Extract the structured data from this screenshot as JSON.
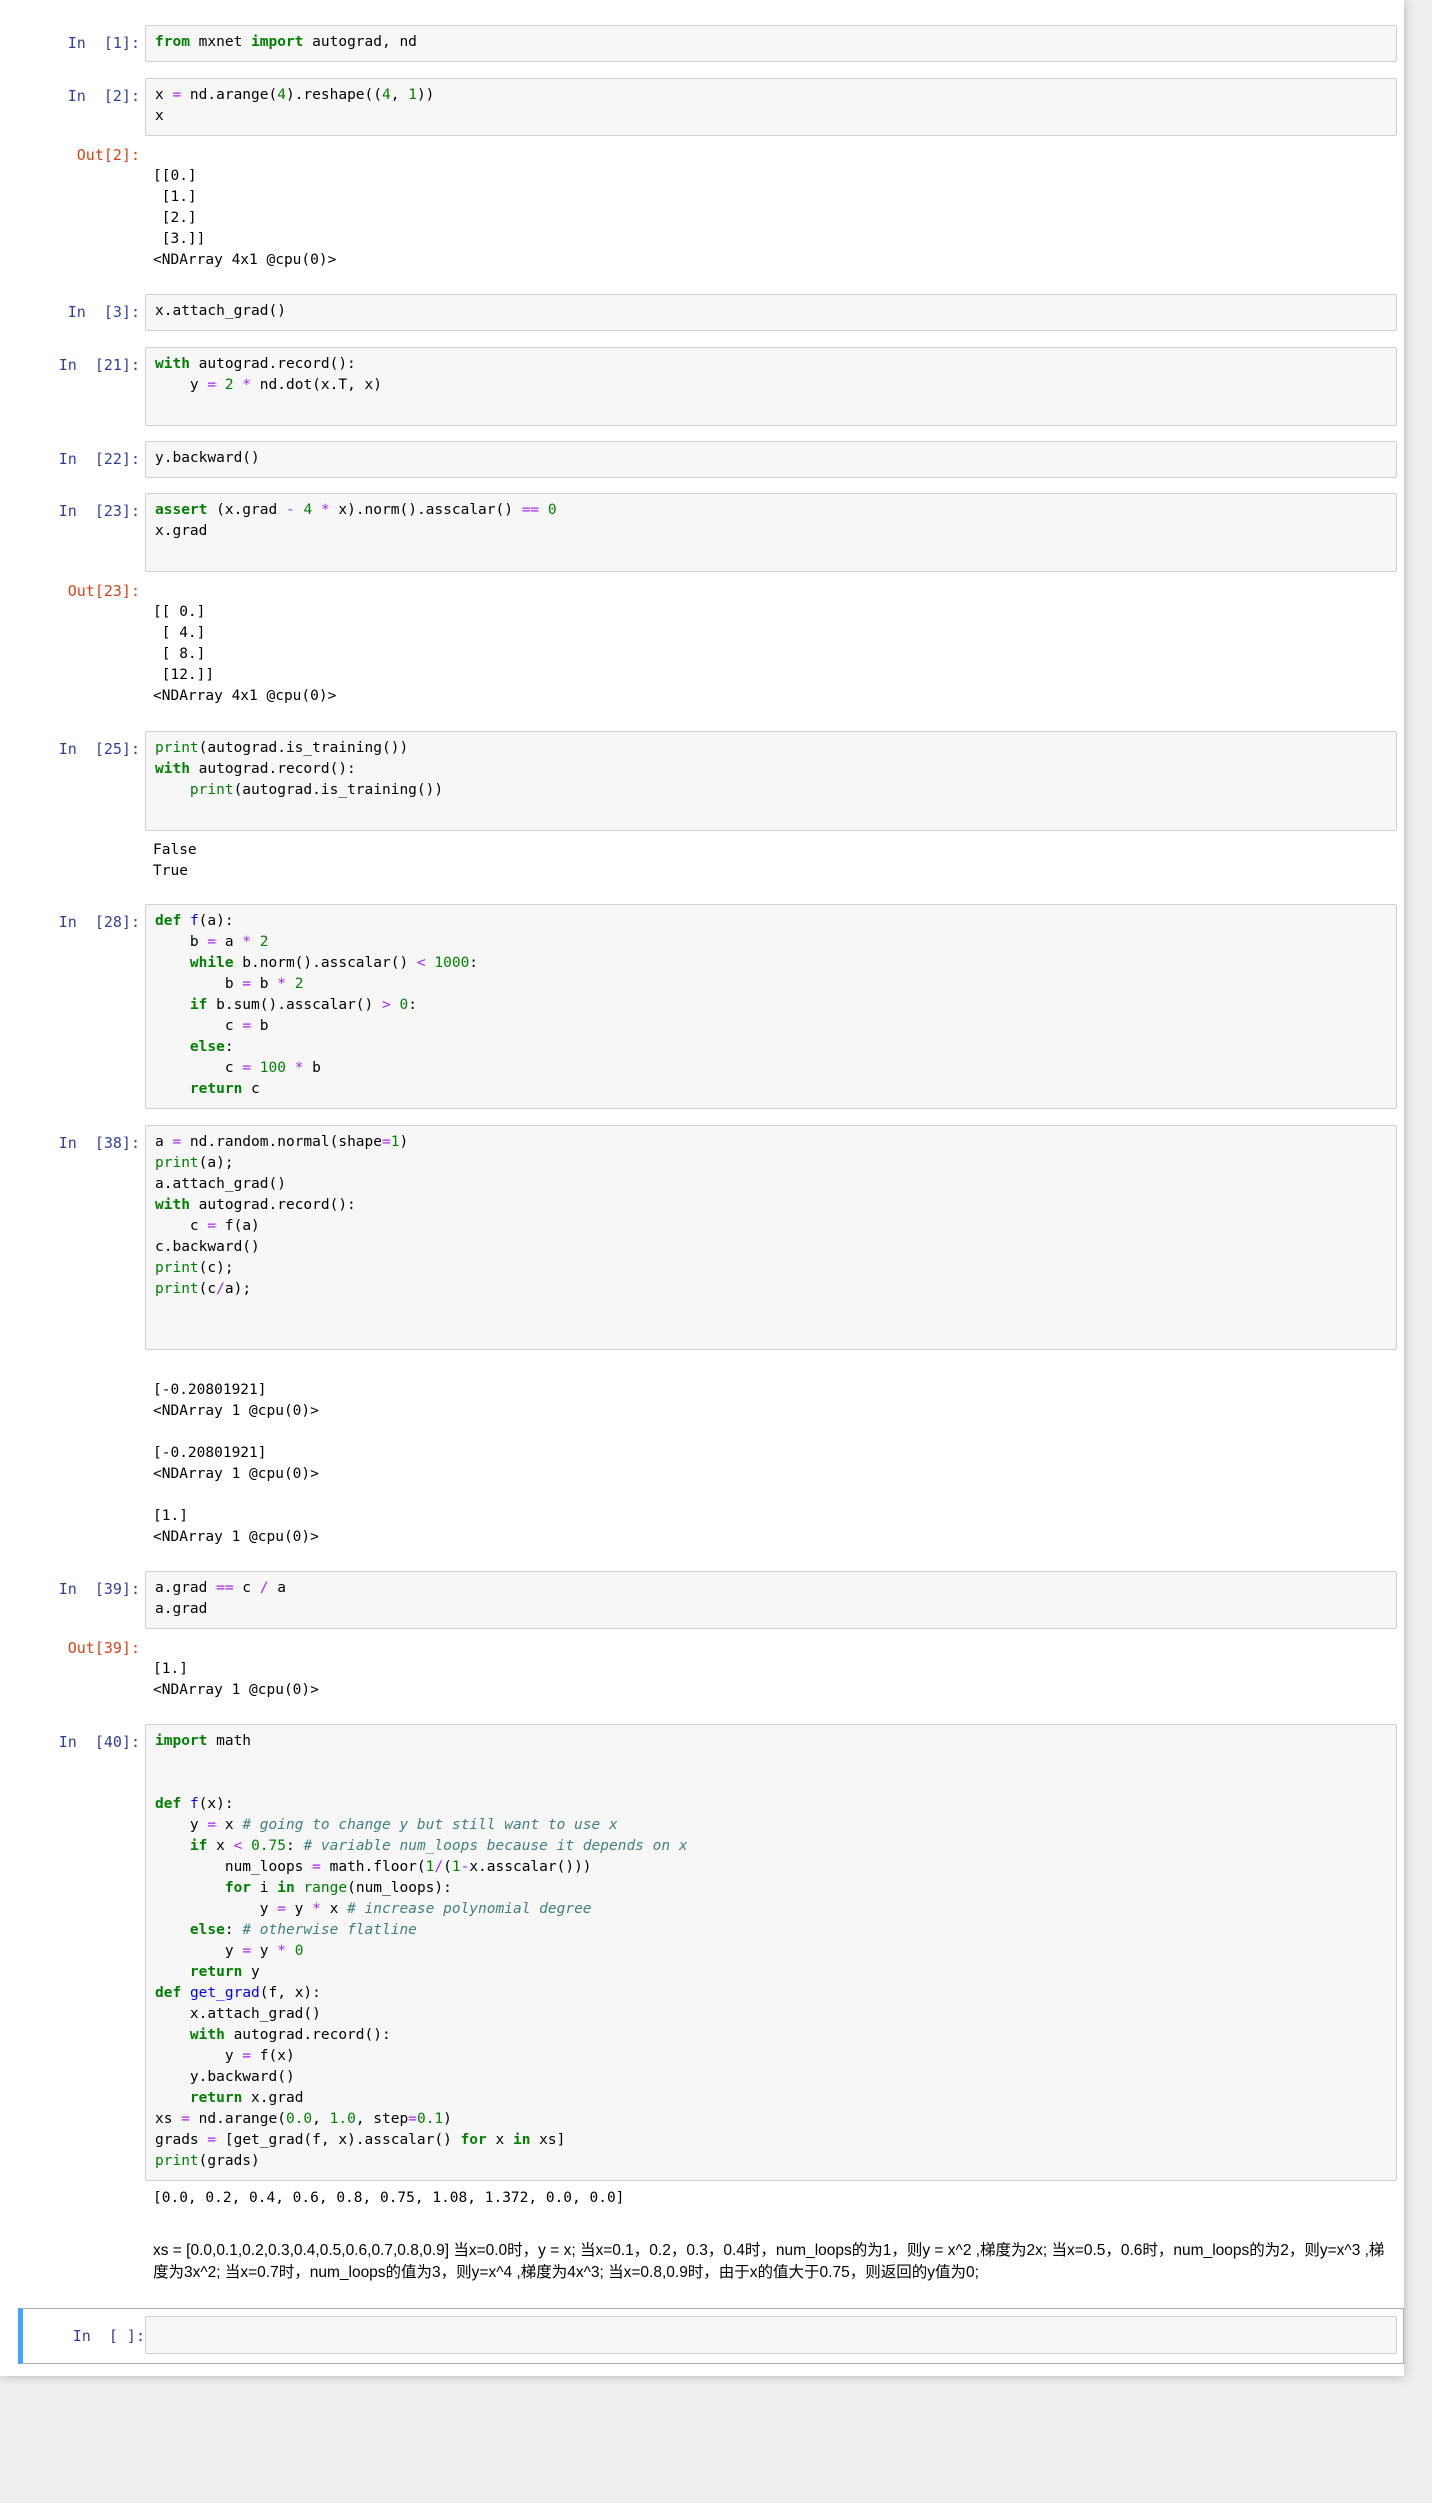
{
  "cells": {
    "c1": {
      "prompt": "In  [1]:"
    },
    "c2": {
      "prompt": "In  [2]:",
      "out_prompt": "Out[2]:",
      "output": "[[0.]\n [1.]\n [2.]\n [3.]]\n<NDArray 4x1 @cpu(0)>"
    },
    "c3": {
      "prompt": "In  [3]:"
    },
    "c21": {
      "prompt": "In  [21]:"
    },
    "c22": {
      "prompt": "In  [22]:"
    },
    "c23": {
      "prompt": "In  [23]:",
      "out_prompt": "Out[23]:",
      "output": "[[ 0.]\n [ 4.]\n [ 8.]\n [12.]]\n<NDArray 4x1 @cpu(0)>"
    },
    "c25": {
      "prompt": "In  [25]:",
      "output": "False\nTrue"
    },
    "c28": {
      "prompt": "In  [28]:"
    },
    "c38": {
      "prompt": "In  [38]:",
      "output": "[-0.20801921]\n<NDArray 1 @cpu(0)>\n\n[-0.20801921]\n<NDArray 1 @cpu(0)>\n\n[1.]\n<NDArray 1 @cpu(0)>"
    },
    "c39": {
      "prompt": "In  [39]:",
      "out_prompt": "Out[39]:",
      "output": "[1.]\n<NDArray 1 @cpu(0)>"
    },
    "c40": {
      "prompt": "In  [40]:",
      "output": "[0.0, 0.2, 0.4, 0.6, 0.8, 0.75, 1.08, 1.372, 0.0, 0.0]"
    },
    "empty": {
      "prompt": "In  [ ]:"
    }
  },
  "markdown": {
    "note": "xs = [0.0,0.1,0.2,0.3,0.4,0.5,0.6,0.7,0.8,0.9] 当x=0.0时，y = x; 当x=0.1，0.2，0.3，0.4时，num_loops的为1，则y = x^2 ,梯度为2x; 当x=0.5，0.6时，num_loops的为2，则y=x^3 ,梯度为3x^2; 当x=0.7时，num_loops的值为3，则y=x^4 ,梯度为4x^3; 当x=0.8,0.9时，由于x的值大于0.75，则返回的y值为0;"
  },
  "colors": {
    "in_prompt": "#303F9F",
    "out_prompt": "#D84315",
    "keyword": "#008000",
    "operator": "#AA22FF",
    "comment": "#408080",
    "selected_bar": "#42A5F5"
  }
}
